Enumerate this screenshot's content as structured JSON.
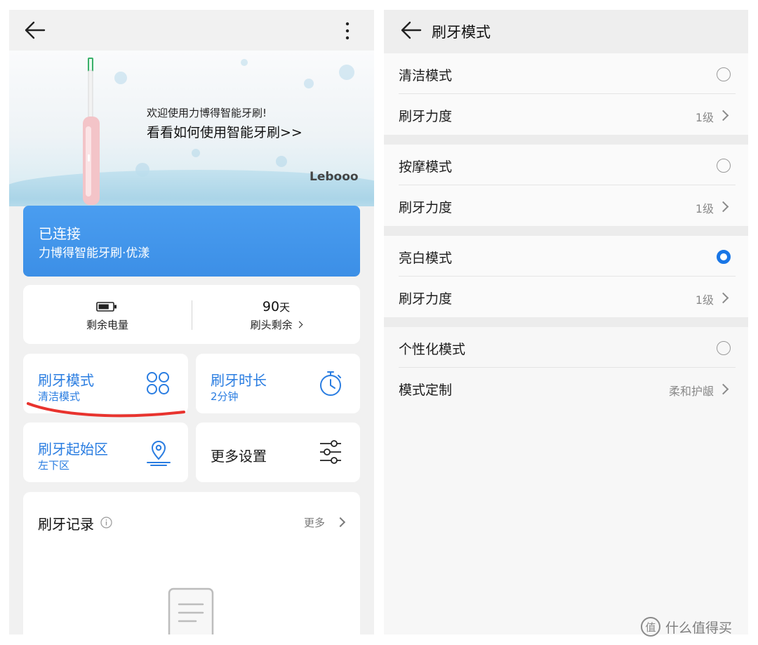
{
  "left": {
    "banner": {
      "line1": "欢迎使用力博得智能牙刷!",
      "line2": "看看如何使用智能牙刷>>",
      "brand": "Lebooo"
    },
    "status": {
      "title": "已连接",
      "device": "力博得智能牙刷·优漾"
    },
    "stats": {
      "battery_label": "剩余电量",
      "battery_level": 0.75,
      "days_value": "90",
      "days_unit": "天",
      "brushhead_label": "刷头剩余"
    },
    "tiles": [
      {
        "title": "刷牙模式",
        "sub": "清洁模式",
        "icon": "grid-icon"
      },
      {
        "title": "刷牙时长",
        "sub": "2分钟",
        "icon": "stopwatch-icon"
      },
      {
        "title": "刷牙起始区",
        "sub": "左下区",
        "icon": "location-icon"
      },
      {
        "title": "更多设置",
        "sub": "",
        "icon": "sliders-icon"
      }
    ],
    "records": {
      "title": "刷牙记录",
      "more": "更多"
    }
  },
  "right": {
    "title": "刷牙模式",
    "groups": [
      {
        "mode": "清洁模式",
        "selected": false,
        "sub_label": "刷牙力度",
        "sub_value": "1级"
      },
      {
        "mode": "按摩模式",
        "selected": false,
        "sub_label": "刷牙力度",
        "sub_value": "1级"
      },
      {
        "mode": "亮白模式",
        "selected": true,
        "sub_label": "刷牙力度",
        "sub_value": "1级"
      },
      {
        "mode": "个性化模式",
        "selected": false,
        "sub_label": "模式定制",
        "sub_value": "柔和护龈"
      }
    ]
  },
  "watermark": "什么值得买",
  "colors": {
    "accent": "#2a7de1",
    "radio_on": "#1976e6",
    "annotation": "#e8332e"
  }
}
